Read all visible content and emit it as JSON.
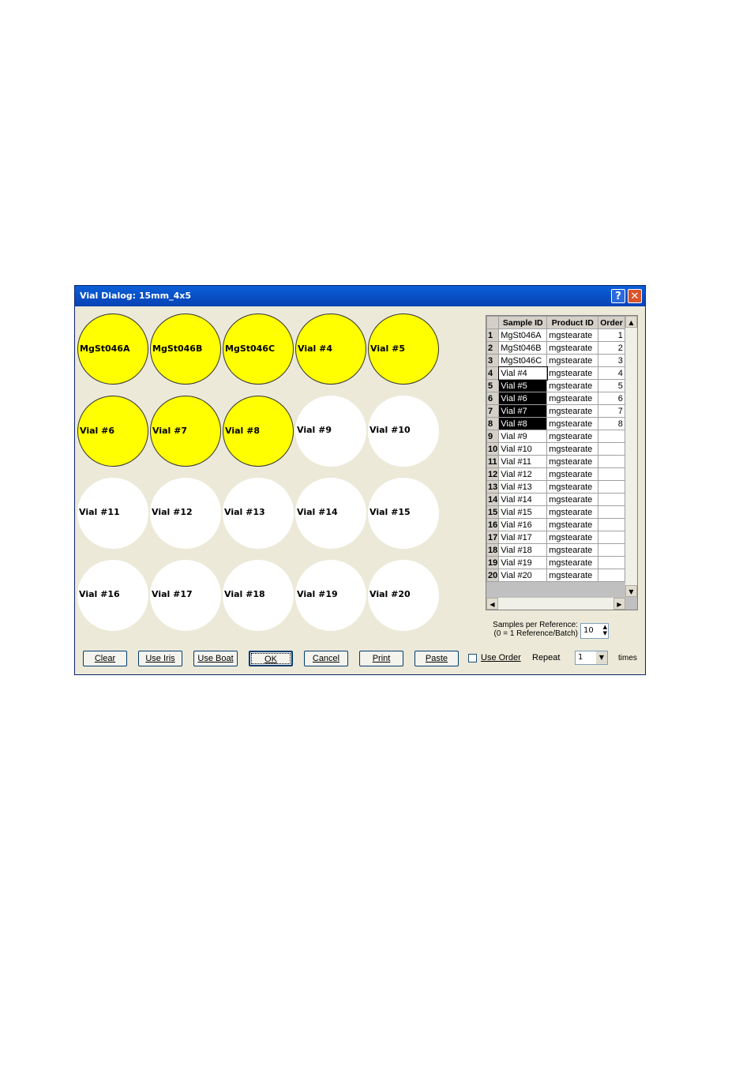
{
  "dialog": {
    "title": "Vial Dialog: 15mm_4x5",
    "help_glyph": "?",
    "close_glyph": "✕"
  },
  "vials": [
    {
      "label": "MgSt046A",
      "state": "selected"
    },
    {
      "label": "MgSt046B",
      "state": "selected"
    },
    {
      "label": "MgSt046C",
      "state": "selected"
    },
    {
      "label": "Vial #4",
      "state": "selected"
    },
    {
      "label": "Vial #5",
      "state": "selected"
    },
    {
      "label": "Vial #6",
      "state": "selected"
    },
    {
      "label": "Vial #7",
      "state": "selected"
    },
    {
      "label": "Vial #8",
      "state": "selected"
    },
    {
      "label": "Vial #9",
      "state": "empty"
    },
    {
      "label": "Vial #10",
      "state": "empty"
    },
    {
      "label": "Vial #11",
      "state": "empty"
    },
    {
      "label": "Vial #12",
      "state": "empty"
    },
    {
      "label": "Vial #13",
      "state": "empty"
    },
    {
      "label": "Vial #14",
      "state": "empty"
    },
    {
      "label": "Vial #15",
      "state": "empty"
    },
    {
      "label": "Vial #16",
      "state": "empty"
    },
    {
      "label": "Vial #17",
      "state": "empty"
    },
    {
      "label": "Vial #18",
      "state": "empty"
    },
    {
      "label": "Vial #19",
      "state": "empty"
    },
    {
      "label": "Vial #20",
      "state": "empty"
    }
  ],
  "colors": {
    "selected_vial": "#ffff00",
    "empty_vial": "#ffffff",
    "dialog_bg": "#ece9d8",
    "titlebar": "#0a5fd8"
  },
  "table": {
    "headers": [
      "Sample ID",
      "Product ID",
      "Order"
    ],
    "rows": [
      {
        "n": "1",
        "sample": "MgSt046A",
        "product": "mgstearate",
        "order": "1"
      },
      {
        "n": "2",
        "sample": "MgSt046B",
        "product": "mgstearate",
        "order": "2"
      },
      {
        "n": "3",
        "sample": "MgSt046C",
        "product": "mgstearate",
        "order": "3"
      },
      {
        "n": "4",
        "sample": "Vial #4",
        "product": "mgstearate",
        "order": "4"
      },
      {
        "n": "5",
        "sample": "Vial #5",
        "product": "mgstearate",
        "order": "5"
      },
      {
        "n": "6",
        "sample": "Vial #6",
        "product": "mgstearate",
        "order": "6"
      },
      {
        "n": "7",
        "sample": "Vial #7",
        "product": "mgstearate",
        "order": "7"
      },
      {
        "n": "8",
        "sample": "Vial #8",
        "product": "mgstearate",
        "order": "8"
      },
      {
        "n": "9",
        "sample": "Vial #9",
        "product": "mgstearate",
        "order": ""
      },
      {
        "n": "10",
        "sample": "Vial #10",
        "product": "mgstearate",
        "order": ""
      },
      {
        "n": "11",
        "sample": "Vial #11",
        "product": "mgstearate",
        "order": ""
      },
      {
        "n": "12",
        "sample": "Vial #12",
        "product": "mgstearate",
        "order": ""
      },
      {
        "n": "13",
        "sample": "Vial #13",
        "product": "mgstearate",
        "order": ""
      },
      {
        "n": "14",
        "sample": "Vial #14",
        "product": "mgstearate",
        "order": ""
      },
      {
        "n": "15",
        "sample": "Vial #15",
        "product": "mgstearate",
        "order": ""
      },
      {
        "n": "16",
        "sample": "Vial #16",
        "product": "mgstearate",
        "order": ""
      },
      {
        "n": "17",
        "sample": "Vial #17",
        "product": "mgstearate",
        "order": ""
      },
      {
        "n": "18",
        "sample": "Vial #18",
        "product": "mgstearate",
        "order": ""
      },
      {
        "n": "19",
        "sample": "Vial #19",
        "product": "mgstearate",
        "order": ""
      },
      {
        "n": "20",
        "sample": "Vial #20",
        "product": "mgstearate",
        "order": ""
      }
    ],
    "current_row": "4",
    "highlighted_rows": [
      "5",
      "6",
      "7",
      "8"
    ]
  },
  "samples_per_reference": {
    "label_line1": "Samples per Reference:",
    "label_line2": "(0 = 1 Reference/Batch)",
    "value": "10"
  },
  "buttons": {
    "clear": "Clear",
    "use_iris": "Use Iris",
    "use_boat": "Use Boat",
    "ok": "OK",
    "cancel": "Cancel",
    "print": "Print",
    "paste": "Paste"
  },
  "use_order": {
    "label": "Use Order",
    "checked": false
  },
  "repeat": {
    "label": "Repeat",
    "value": "1",
    "suffix": "times"
  }
}
